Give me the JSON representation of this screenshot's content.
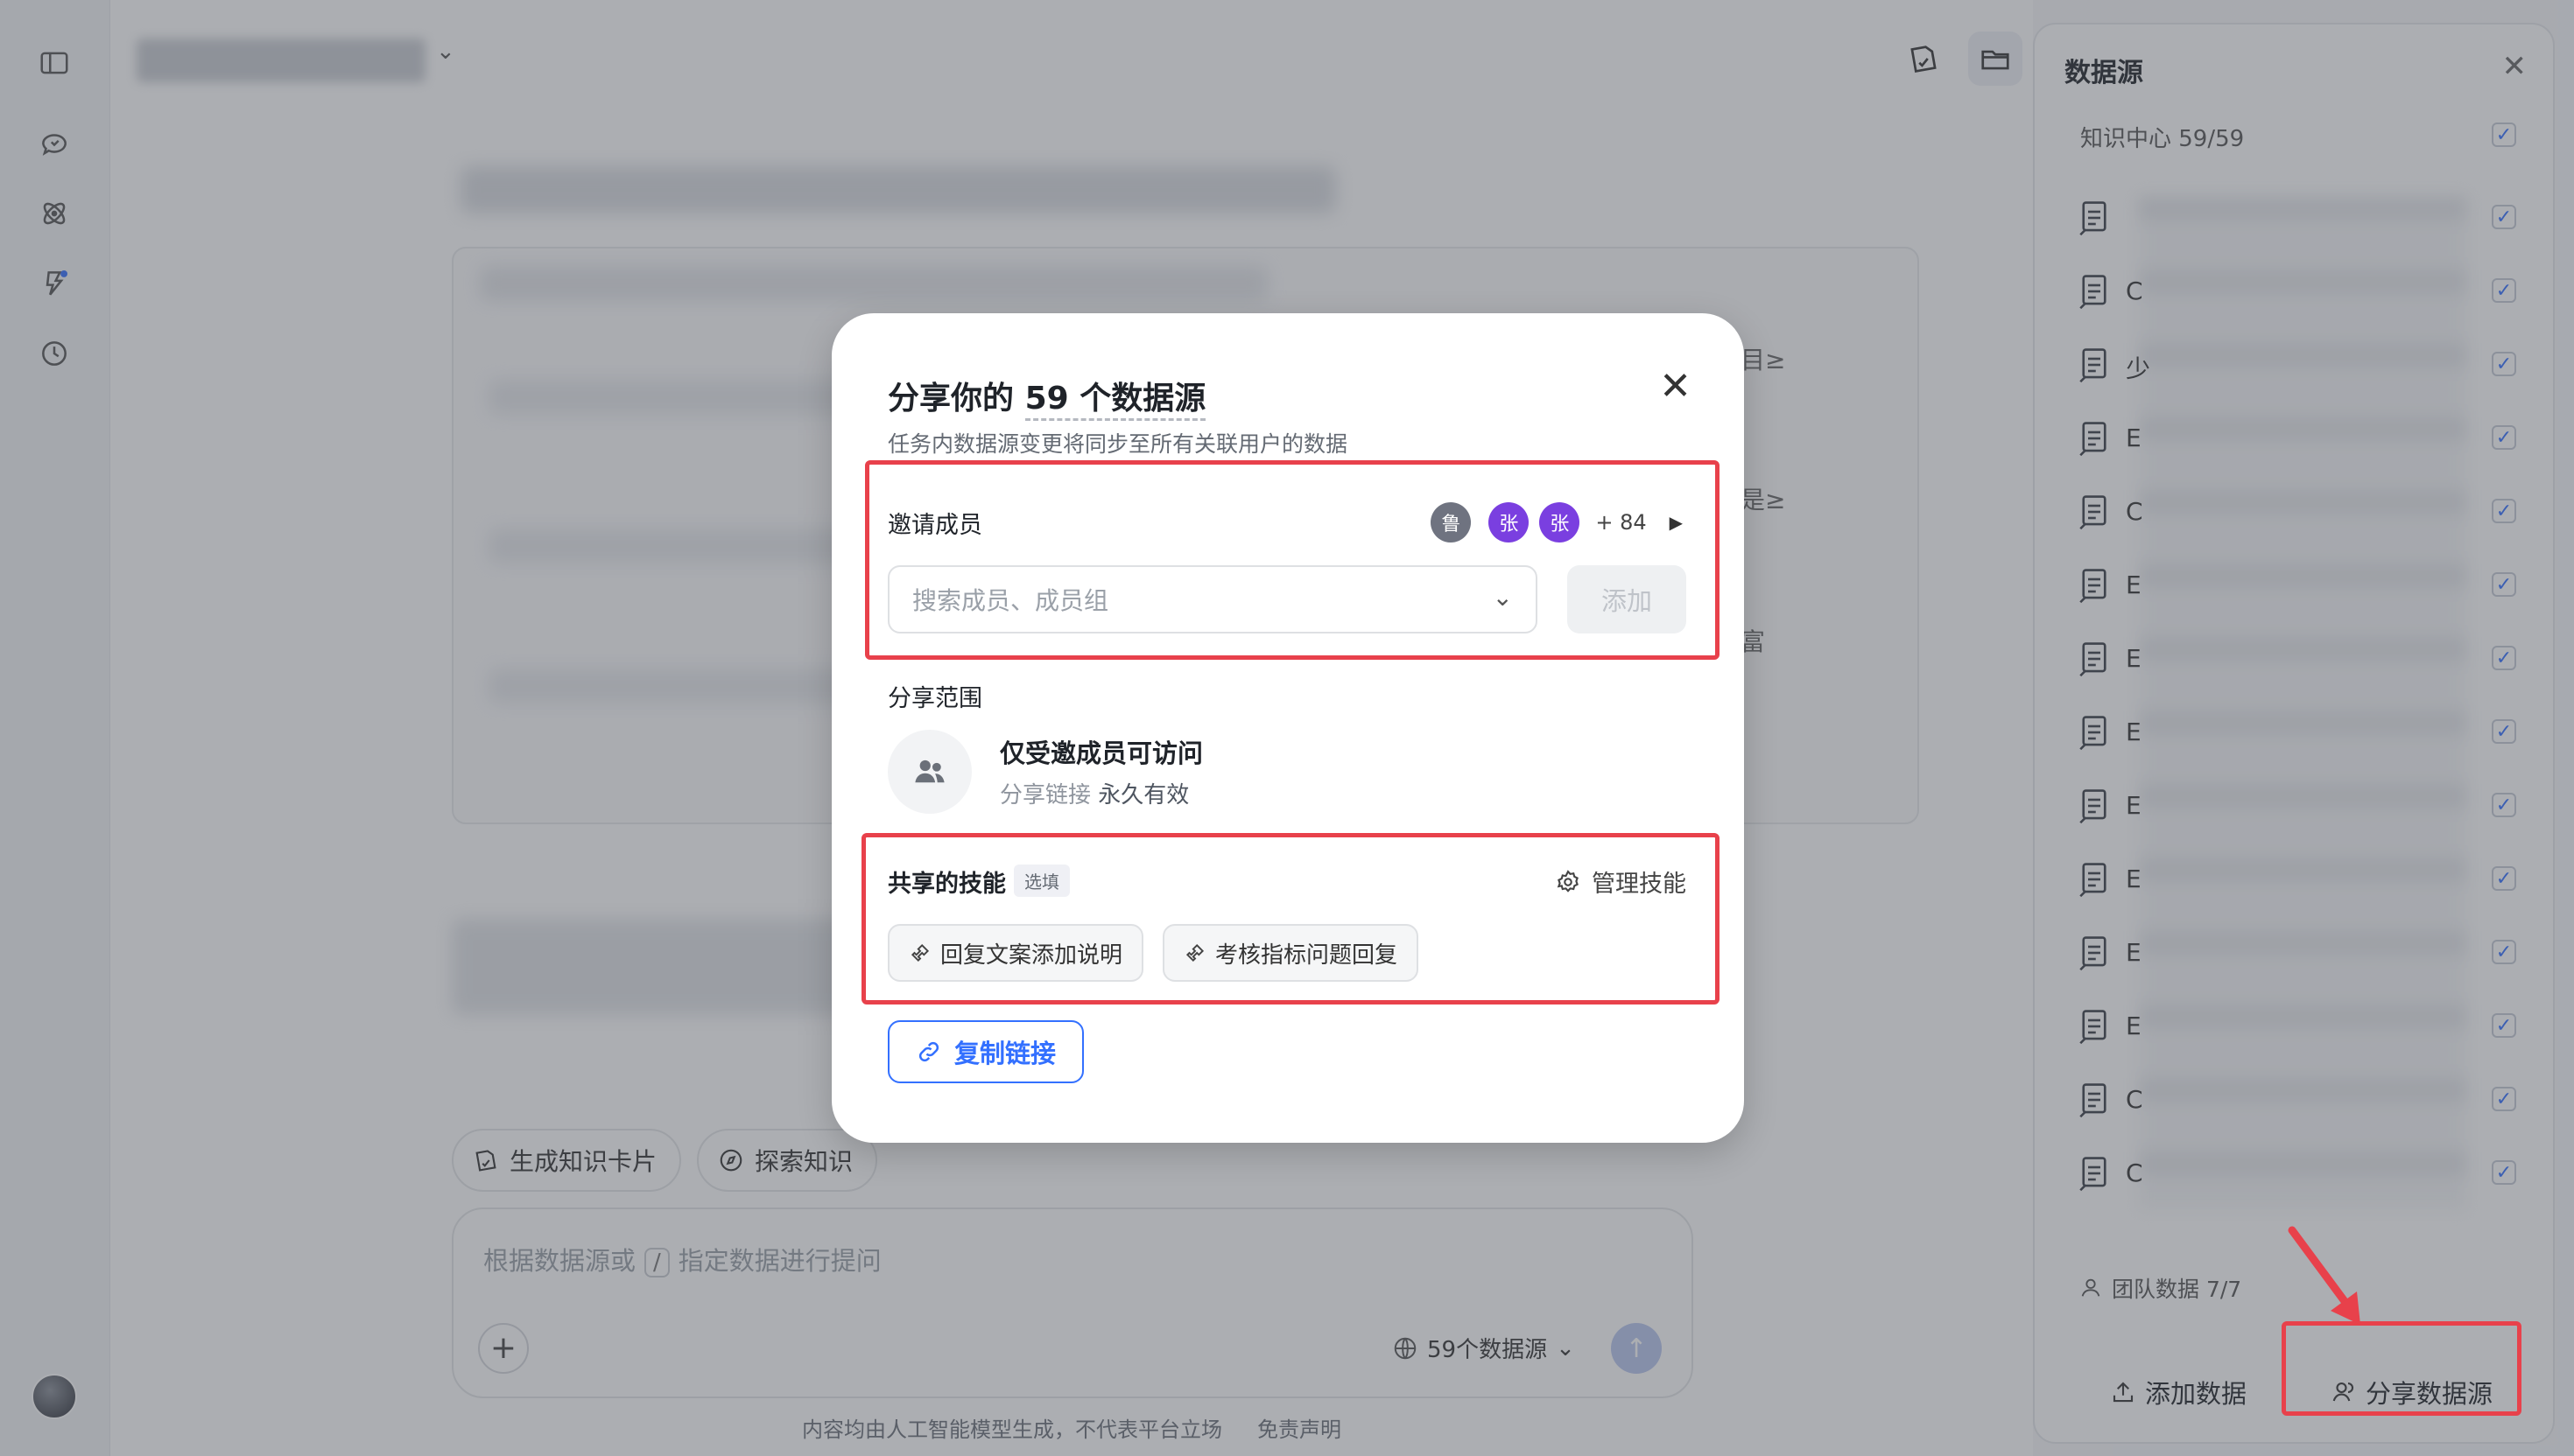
{
  "sidebar": {
    "icons": [
      "sidebar-toggle-icon",
      "chat-refresh-icon",
      "atom-icon",
      "lightning-icon",
      "history-clock-icon"
    ]
  },
  "header": {
    "icons": [
      "knowledge-card-icon",
      "folder-icon"
    ]
  },
  "composer": {
    "chips": [
      {
        "label": "生成知识卡片",
        "icon": "knowledge-card-icon"
      },
      {
        "label": "探索知识",
        "icon": "compass-icon"
      }
    ],
    "placeholder_pre": "根据数据源或",
    "slash": "/",
    "placeholder_post": "指定数据进行提问",
    "datasource_count": "59个数据源",
    "footer_note": "内容均由人工智能模型生成，不代表平台立场",
    "disclaimer": "免责声明"
  },
  "right_panel": {
    "title": "数据源",
    "knowledge_center": "知识中心 59/59",
    "items": [
      {
        "letter": ""
      },
      {
        "letter": "C"
      },
      {
        "letter": "少"
      },
      {
        "letter": "E"
      },
      {
        "letter": "C"
      },
      {
        "letter": "E"
      },
      {
        "letter": "E"
      },
      {
        "letter": "E"
      },
      {
        "letter": "E"
      },
      {
        "letter": "E"
      },
      {
        "letter": "E"
      },
      {
        "letter": "E"
      },
      {
        "letter": "C"
      },
      {
        "letter": "C"
      }
    ],
    "team_data": "团队数据 7/7",
    "add_data": "添加数据",
    "share_data": "分享数据源"
  },
  "modal": {
    "title_pre": "分享你的",
    "title_count": "59 个数据源",
    "subtitle": "任务内数据源变更将同步至所有关联用户的数据",
    "invite_label": "邀请成员",
    "avatars": [
      "鲁",
      "张",
      "张"
    ],
    "more_count": "+ 84",
    "search_placeholder": "搜索成员、成员组",
    "add_button": "添加",
    "scope_label": "分享范围",
    "scope_title": "仅受邀成员可访问",
    "scope_link_label": "分享链接",
    "scope_link_value": "永久有效",
    "skills_label": "共享的技能",
    "optional_tag": "选填",
    "manage_skills": "管理技能",
    "skills": [
      "回复文案添加说明",
      "考核指标问题回复"
    ],
    "copy_link": "复制链接"
  },
  "bg_fragments": [
    "目≥",
    "是≥",
    "富"
  ],
  "colors": {
    "accent": "#3370ff",
    "annotation": "#e8414b",
    "avatar_purple": "#7a3fe0",
    "avatar_grey": "#6f7380"
  }
}
